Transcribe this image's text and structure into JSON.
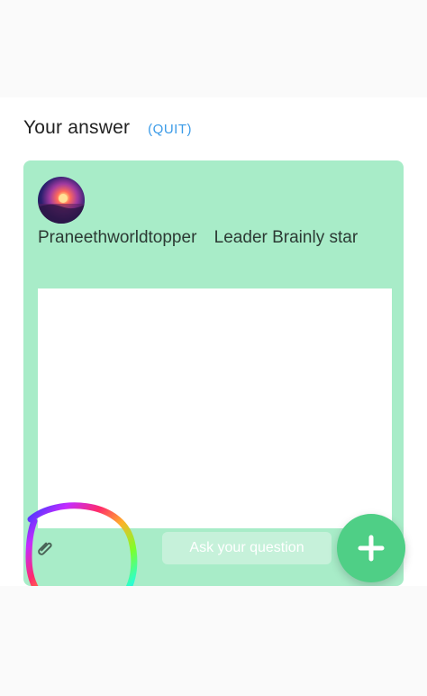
{
  "answer_section": {
    "title": "Your answer",
    "quit_label": "(QUIT)"
  },
  "card": {
    "user_name": "Praneethworldtopper",
    "user_rank": "Leader Brainly star",
    "editor_text": ""
  },
  "bottom_bar": {
    "attach_icon": "paperclip-icon",
    "ask_label": "Ask your question",
    "fab_icon": "plus-icon"
  },
  "colors": {
    "card_bg": "#a8ecc8",
    "quit_link": "#3b9be8",
    "fab_bg": "#4fcf86",
    "ask_button_bg": "#c6f1da"
  }
}
